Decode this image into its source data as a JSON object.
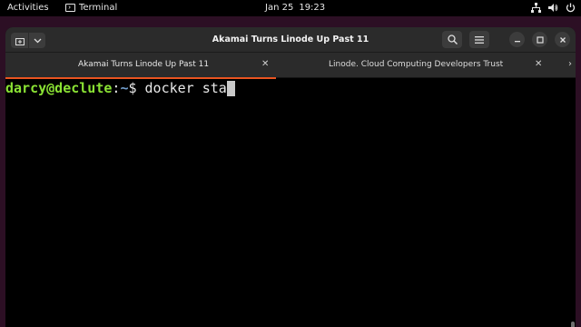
{
  "topbar": {
    "activities": "Activities",
    "app_name": "Terminal",
    "date": "Jan 25",
    "time": "19:23",
    "icons": [
      "network-icon",
      "volume-icon",
      "power-icon"
    ]
  },
  "window": {
    "title": "Akamai Turns Linode Up Past 11",
    "buttons": [
      "new-tab-icon",
      "chevron-down-icon",
      "search-icon",
      "hamburger-menu-icon",
      "minimize-icon",
      "maximize-icon",
      "close-icon"
    ]
  },
  "tabs": [
    {
      "label": "Akamai Turns Linode Up Past 11",
      "active": true
    },
    {
      "label": "Linode. Cloud Computing Developers Trust",
      "active": false
    }
  ],
  "terminal": {
    "user_host": "darcy@declute",
    "colon": ":",
    "path": "~",
    "prompt_symbol": "$ ",
    "command": "docker sta"
  },
  "colors": {
    "accent": "#e95420",
    "prompt_user": "#8ae234",
    "prompt_path": "#729fcf",
    "wallpaper": "#2c0f24"
  }
}
